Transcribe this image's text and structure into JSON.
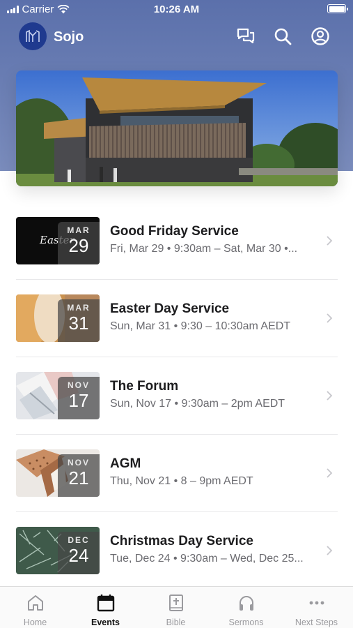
{
  "status_bar": {
    "carrier": "Carrier",
    "time": "10:26 AM"
  },
  "app": {
    "title": "Sojo"
  },
  "header_icons": [
    "chat-bubbles-icon",
    "search-icon",
    "profile-icon"
  ],
  "events": [
    {
      "title": "Good Friday Service",
      "subtitle": "Fri, Mar 29 • 9:30am – Sat, Mar 30 •...",
      "month": "MAR",
      "day": "29",
      "thumb_text": "Easter",
      "thumb": "dark"
    },
    {
      "title": "Easter Day Service",
      "subtitle": "Sun, Mar 31 • 9:30 – 10:30am AEDT",
      "month": "MAR",
      "day": "31",
      "thumb": "bread"
    },
    {
      "title": "The Forum",
      "subtitle": "Sun, Nov 17 • 9:30am – 2pm AEDT",
      "month": "NOV",
      "day": "17",
      "thumb": "books"
    },
    {
      "title": "AGM",
      "subtitle": "Thu, Nov 21 • 8 – 9pm AEDT",
      "month": "NOV",
      "day": "21",
      "thumb": "pegboard"
    },
    {
      "title": "Christmas Day Service",
      "subtitle": "Tue, Dec 24 • 9:30am – Wed, Dec 25...",
      "month": "DEC",
      "day": "24",
      "thumb": "pine"
    }
  ],
  "tabs": [
    {
      "label": "Home",
      "icon": "home-icon",
      "active": false
    },
    {
      "label": "Events",
      "icon": "calendar-icon",
      "active": true
    },
    {
      "label": "Bible",
      "icon": "bible-icon",
      "active": false
    },
    {
      "label": "Sermons",
      "icon": "headphones-icon",
      "active": false
    },
    {
      "label": "Next Steps",
      "icon": "more-icon",
      "active": false
    }
  ],
  "colors": {
    "header": "#5b70ab",
    "logo": "#1f3a8f",
    "active_tab": "#111111",
    "inactive_tab": "#9a9a9e"
  }
}
